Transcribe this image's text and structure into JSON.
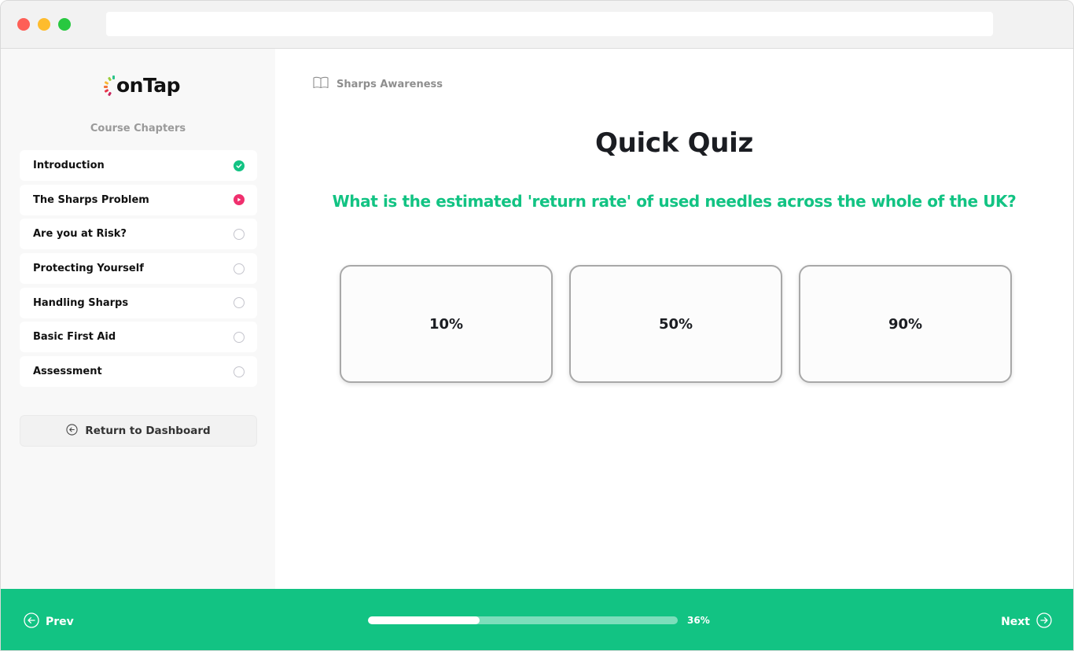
{
  "browser": {
    "url": ""
  },
  "brand": {
    "logo_text": "onTap",
    "accent_color": "#12c383",
    "current_color": "#f0306e"
  },
  "sidebar": {
    "heading": "Course Chapters",
    "chapters": [
      {
        "label": "Introduction",
        "status": "completed",
        "icon": "check-circle-icon"
      },
      {
        "label": "The Sharps Problem",
        "status": "current",
        "icon": "play-circle-icon"
      },
      {
        "label": "Are you at Risk?",
        "status": "not-started",
        "icon": "empty-circle-icon"
      },
      {
        "label": "Protecting Yourself",
        "status": "not-started",
        "icon": "empty-circle-icon"
      },
      {
        "label": "Handling Sharps",
        "status": "not-started",
        "icon": "empty-circle-icon"
      },
      {
        "label": "Basic First Aid",
        "status": "not-started",
        "icon": "empty-circle-icon"
      },
      {
        "label": "Assessment",
        "status": "not-started",
        "icon": "empty-circle-icon"
      }
    ],
    "return_button": {
      "label": "Return to Dashboard",
      "icon": "arrow-left-circle-icon"
    }
  },
  "main": {
    "breadcrumb": {
      "icon": "book-icon",
      "label": "Sharps Awareness"
    },
    "title": "Quick Quiz",
    "question": "What is the estimated 'return rate' of used needles across the whole of the UK?",
    "answers": [
      {
        "label": "10%"
      },
      {
        "label": "50%"
      },
      {
        "label": "90%"
      }
    ]
  },
  "footer": {
    "prev": {
      "label": "Prev",
      "icon": "arrow-left-circle-icon"
    },
    "next": {
      "label": "Next",
      "icon": "arrow-right-circle-icon"
    },
    "progress": {
      "percent": 36,
      "label": "36%"
    }
  }
}
